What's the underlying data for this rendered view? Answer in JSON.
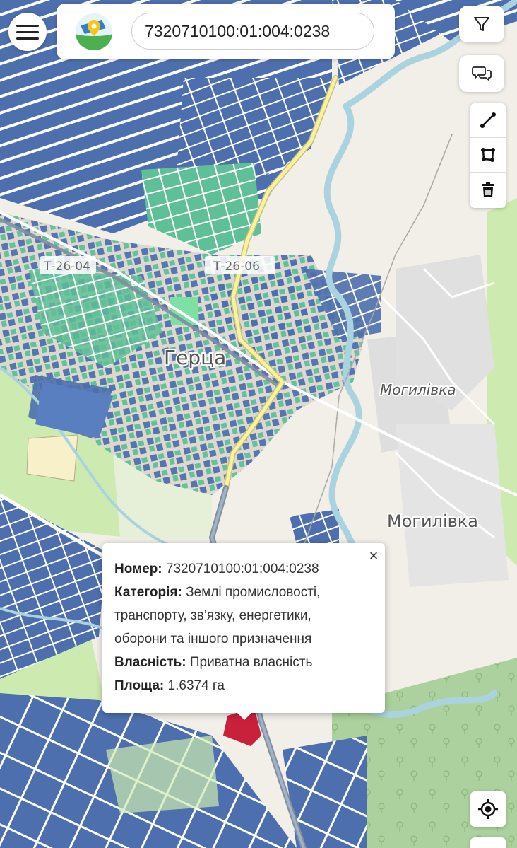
{
  "header": {
    "search_value": "7320710100:01:004:0238",
    "menu_icon": "hamburger-menu-icon",
    "logo_icon": "map-pin-logo-icon"
  },
  "tools": {
    "filter_icon": "filter-icon",
    "feedback_icon": "chat-bubbles-icon",
    "draw_line_icon": "draw-line-icon",
    "draw_polygon_icon": "draw-polygon-icon",
    "delete_icon": "trash-icon",
    "locate_icon": "locate-crosshair-icon"
  },
  "map": {
    "labels": {
      "town": "Герца",
      "village_italic": "Могилівка",
      "village": "Могилівка",
      "road_1": "Т-26-04",
      "road_2": "Т-26-06"
    },
    "colors": {
      "background": "#f2efe9",
      "parcel_blue": "#4e6fae",
      "parcel_green": "#5fbf96",
      "parcel_outline": "#ffffff",
      "river": "#aad3df",
      "main_road": "#f7f29b",
      "forest": "#add19e",
      "grass": "#cdebb0",
      "highlight_parcel": "#c9213b"
    }
  },
  "popup": {
    "number_label": "Номер:",
    "number_value": "7320710100:01:004:0238",
    "category_label": "Категорія:",
    "category_value_1": "Землі промисловості,",
    "category_value_2": "транспорту, зв’язку, енергетики,",
    "category_value_3": "оборони та іншого призначення",
    "ownership_label": "Власність:",
    "ownership_value": "Приватна власність",
    "area_label": "Площа:",
    "area_value": "1.6374 га",
    "close_label": "×"
  }
}
